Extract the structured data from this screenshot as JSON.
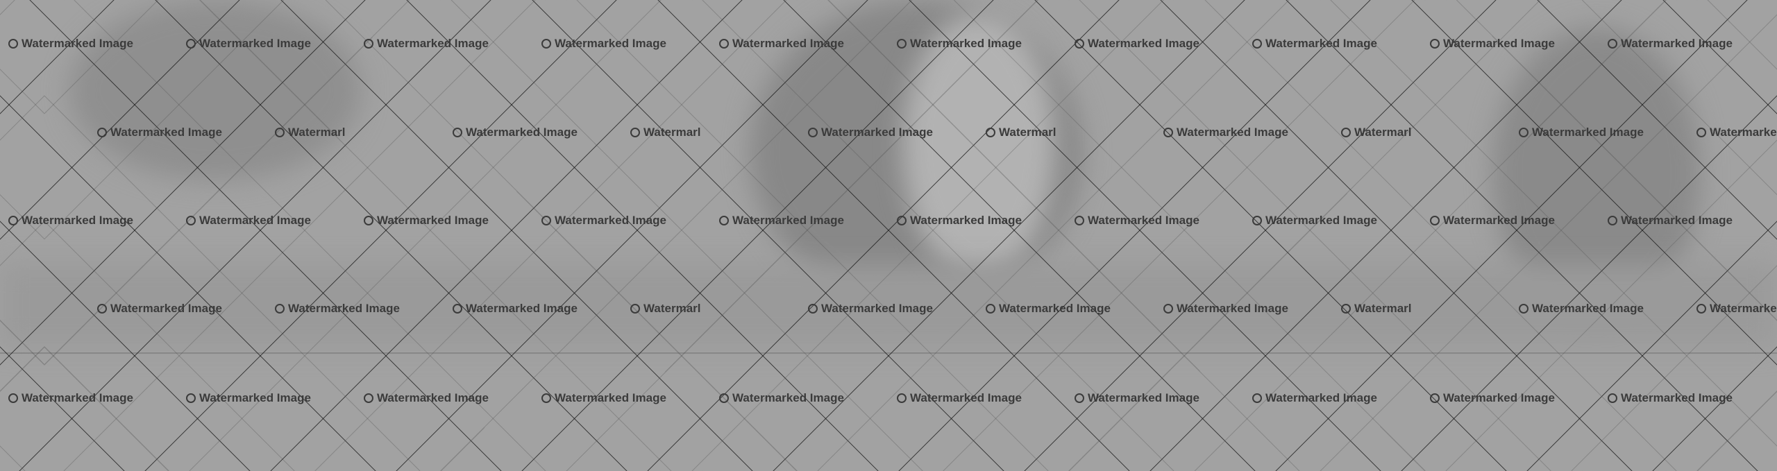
{
  "watermark": {
    "label": "Watermarked Image",
    "truncated_label": "Watermarl"
  },
  "colors": {
    "background": "#a2a2a2",
    "watermark_text": "#3b3b3b",
    "grid_line": "#141414"
  }
}
